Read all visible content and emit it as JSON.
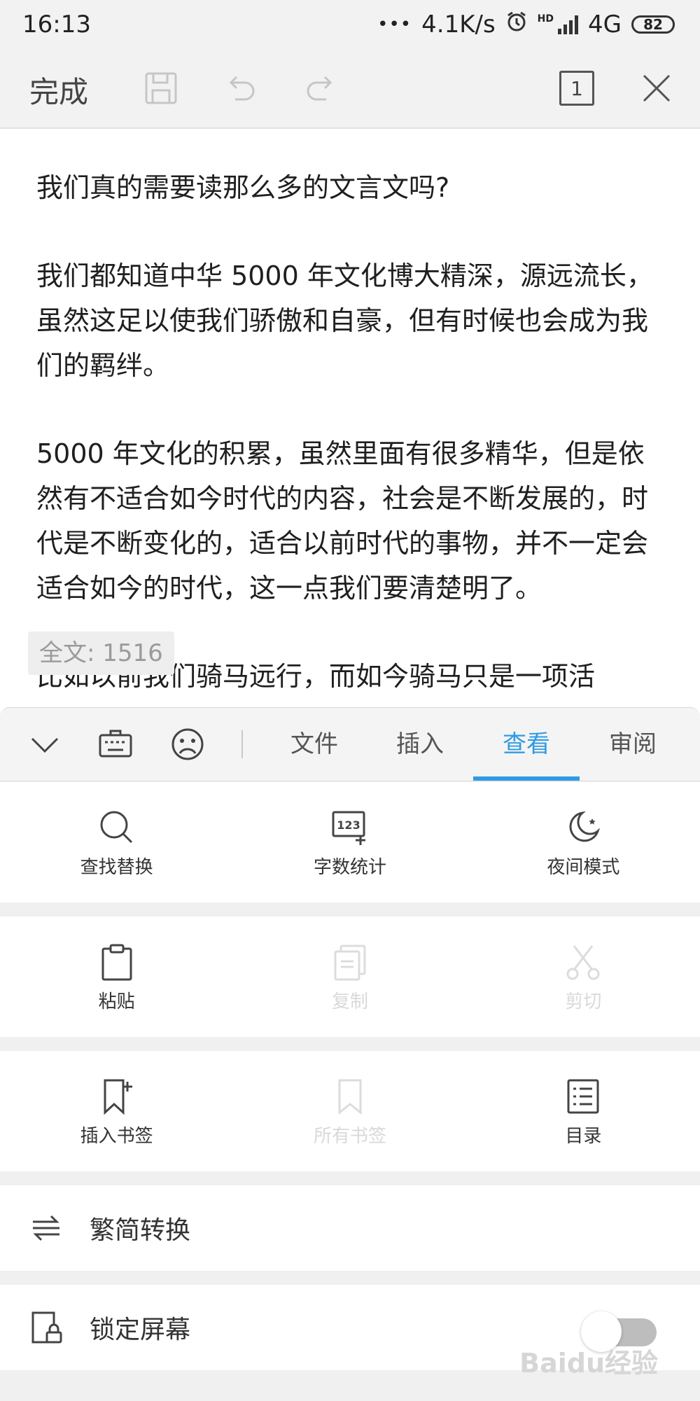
{
  "status_bar": {
    "time": "16:13",
    "dots": "•••",
    "network_speed": "4.1K/s",
    "hd_label": "HD",
    "network_type": "4G",
    "battery": "82"
  },
  "toolbar": {
    "done_label": "完成",
    "page_count": "1"
  },
  "document": {
    "paragraphs": [
      "我们真的需要读那么多的文言文吗?",
      "我们都知道中华 5000 年文化博大精深，源远流长，虽然这足以使我们骄傲和自豪，但有时候也会成为我们的羁绊。",
      "5000 年文化的积累，虽然里面有很多精华，但是依然有不适合如今时代的内容，社会是不断发展的，时代是不断变化的，适合以前时代的事物，并不一定会适合如今的时代，这一点我们要清楚明了。",
      "比如以前我们骑马远行，而如今骑马只是一项活"
    ],
    "word_count": "全文: 1516"
  },
  "panel": {
    "tabs": [
      "文件",
      "插入",
      "查看",
      "审阅"
    ],
    "active_tab": "查看",
    "accent_color": "#2f9be5",
    "row1": [
      "查找替换",
      "字数统计",
      "夜间模式"
    ],
    "row2": [
      "粘贴",
      "复制",
      "剪切"
    ],
    "row3": [
      "插入书签",
      "所有书签",
      "目录"
    ],
    "convert_label": "繁简转换",
    "lock_label": "锁定屏幕",
    "lock_enabled": false
  },
  "watermark": "Baidu经验"
}
